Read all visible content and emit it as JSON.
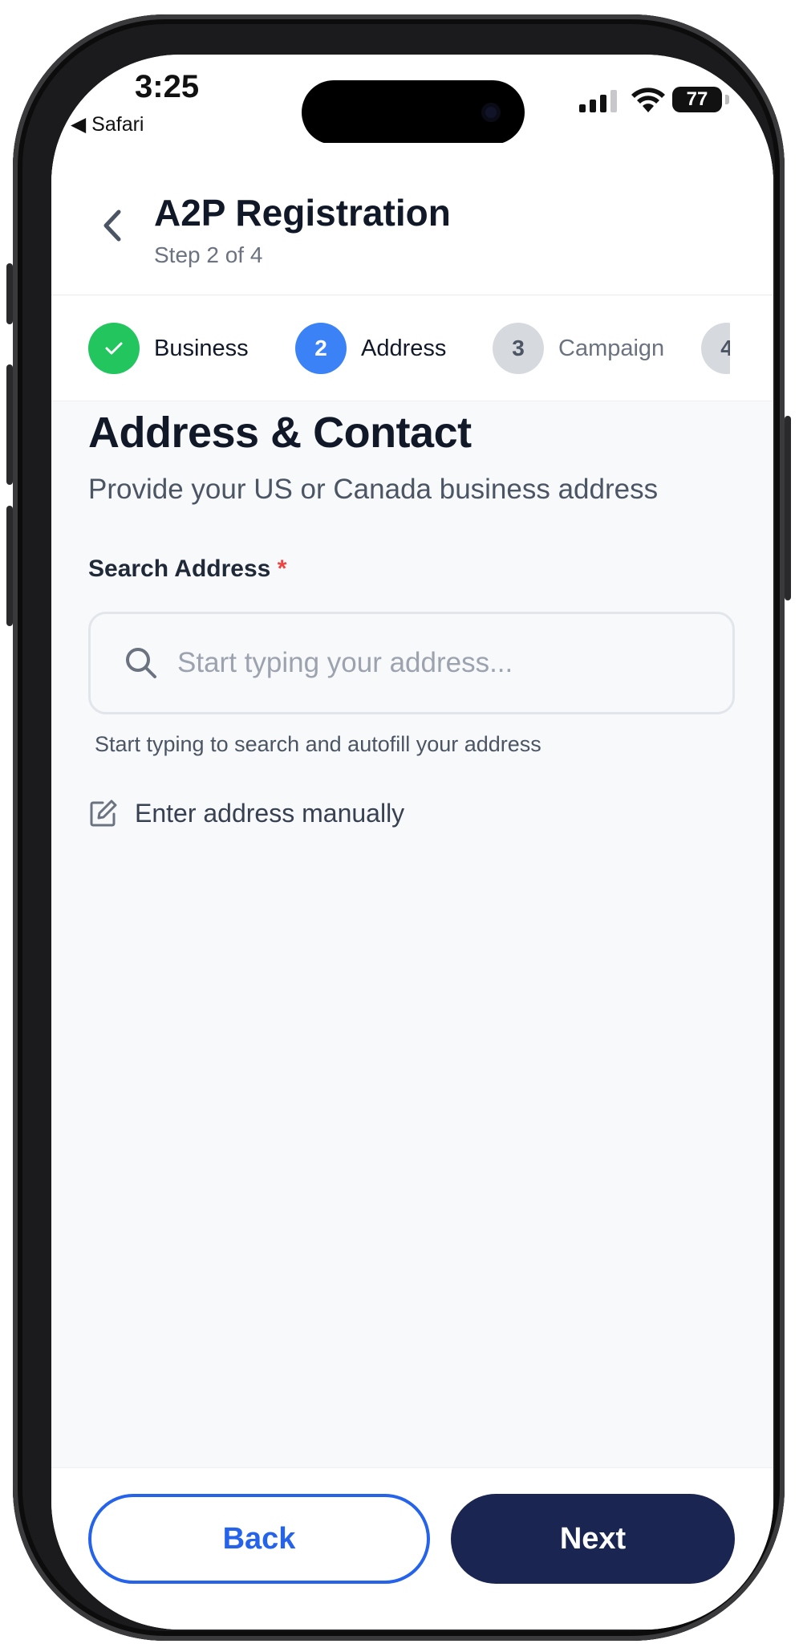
{
  "status_bar": {
    "time": "3:25",
    "back_app": "◀ Safari",
    "battery": "77"
  },
  "header": {
    "title": "A2P Registration",
    "subtitle": "Step 2 of 4"
  },
  "stepper": {
    "steps": [
      {
        "number": "1",
        "label": "Business",
        "state": "completed"
      },
      {
        "number": "2",
        "label": "Address",
        "state": "active"
      },
      {
        "number": "3",
        "label": "Campaign",
        "state": "pending"
      },
      {
        "number": "4",
        "label": "",
        "state": "pending"
      }
    ]
  },
  "main": {
    "section_title": "Address & Contact",
    "section_description": "Provide your US or Canada business address",
    "search_label": "Search Address",
    "required_marker": "*",
    "search_placeholder": "Start typing your address...",
    "search_value": "",
    "helper_text": "Start typing to search and autofill your address",
    "manual_entry_label": "Enter address manually"
  },
  "footer": {
    "back_label": "Back",
    "next_label": "Next"
  },
  "colors": {
    "primary_blue": "#3b82f6",
    "success_green": "#22c55e",
    "navy_button": "#1a2552",
    "required_red": "#ef4444"
  },
  "icons": [
    "chevron-left-icon",
    "check-icon",
    "search-icon",
    "edit-square-icon",
    "signal-icon",
    "wifi-icon",
    "battery-icon"
  ]
}
